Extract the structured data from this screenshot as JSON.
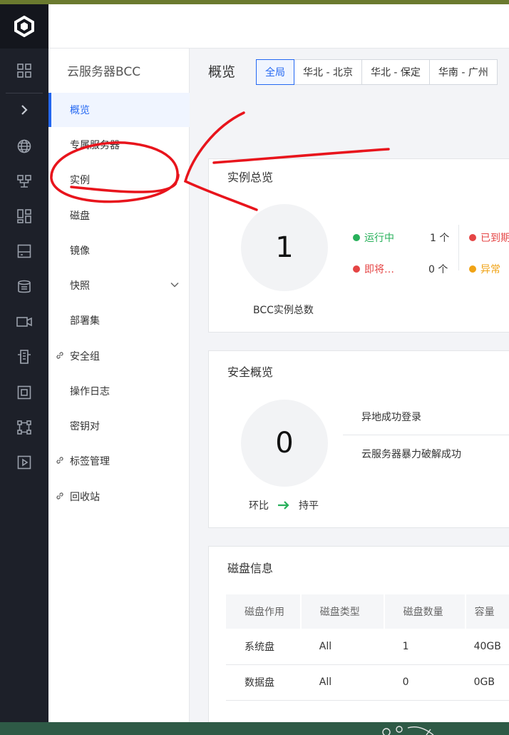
{
  "app": {
    "product_title": "云服务器BCC"
  },
  "rail": {
    "icons": [
      "grid-icon",
      "chevron-right-icon",
      "globe-icon",
      "network-icon",
      "dashboard-icon",
      "storage-icon",
      "database-icon",
      "video-icon",
      "building-icon",
      "device-icon",
      "connect-icon",
      "play-icon"
    ]
  },
  "submenu": {
    "items": [
      {
        "label": "概览",
        "active": true
      },
      {
        "label": "专属服务器"
      },
      {
        "label": "实例"
      },
      {
        "label": "磁盘"
      },
      {
        "label": "镜像"
      },
      {
        "label": "快照",
        "expandable": true
      },
      {
        "label": "部署集"
      },
      {
        "label": "安全组",
        "link": true
      },
      {
        "label": "操作日志"
      },
      {
        "label": "密钥对"
      },
      {
        "label": "标签管理",
        "link": true
      },
      {
        "label": "回收站",
        "link": true
      }
    ]
  },
  "main": {
    "title": "概览",
    "region_tabs": [
      "全局",
      "华北 - 北京",
      "华北 - 保定",
      "华南 - 广州"
    ],
    "instance_overview": {
      "title": "实例总览",
      "total": "1",
      "total_label": "BCC实例总数",
      "stats": [
        {
          "label": "运行中",
          "count": "1 个",
          "color": "#27b05a"
        },
        {
          "label": "即将…",
          "count": "0 个",
          "color": "#e54545"
        },
        {
          "label": "已到期",
          "color": "#e54545"
        },
        {
          "label": "异常",
          "color": "#f0a316"
        }
      ]
    },
    "security_overview": {
      "title": "安全概览",
      "total": "0",
      "trend_label": "环比",
      "trend_value": "持平",
      "items": [
        "异地成功登录",
        "云服务器暴力破解成功"
      ]
    },
    "disk_info": {
      "title": "磁盘信息",
      "columns": [
        "磁盘作用",
        "磁盘类型",
        "磁盘数量",
        "容量"
      ],
      "rows": [
        [
          "系统盘",
          "All",
          "1",
          "40GB"
        ],
        [
          "数据盘",
          "All",
          "0",
          "0GB"
        ]
      ]
    }
  },
  "colors": {
    "accent": "#2468f2",
    "rail_bg": "#1d2029",
    "annotation": "#e8141c"
  }
}
